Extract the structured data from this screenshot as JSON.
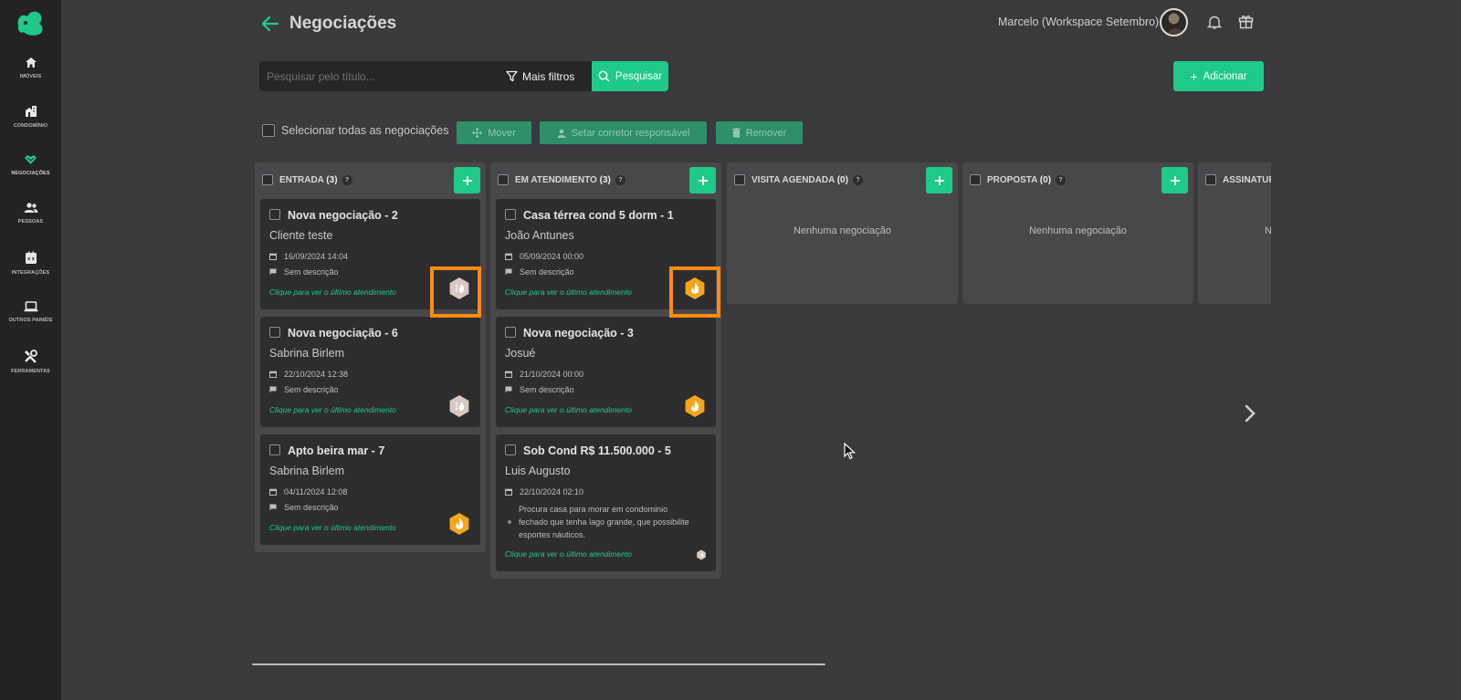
{
  "sidebar": {
    "items": [
      {
        "label": "IMÓVEIS",
        "icon": "home-icon"
      },
      {
        "label": "CONDOMÍNIO",
        "icon": "building-icon"
      },
      {
        "label": "NEGOCIAÇÕES",
        "icon": "handshake-icon"
      },
      {
        "label": "PESSOAS",
        "icon": "people-icon"
      },
      {
        "label": "INTEGRAÇÕES",
        "icon": "integration-icon"
      },
      {
        "label": "OUTROS PAINÉIS",
        "icon": "laptop-icon"
      },
      {
        "label": "FERRAMENTAS",
        "icon": "tools-icon"
      }
    ],
    "active": "NEGOCIAÇÕES"
  },
  "header": {
    "title": "Negociações",
    "user": "Marcelo (Workspace Setembro)"
  },
  "toolbar": {
    "search_placeholder": "Pesquisar pelo título...",
    "more_filters": "Mais filtros",
    "search_button": "Pesquisar",
    "add_button": "Adicionar"
  },
  "bulk": {
    "select_all": "Selecionar todas as negociações",
    "move": "Mover",
    "set_broker": "Setar corretor responsável",
    "remove": "Remover"
  },
  "columns": [
    {
      "title": "ENTRADA",
      "count": "(3)",
      "cards": [
        {
          "title": "Nova negociação - 2",
          "client": "Cliente teste",
          "date": "16/09/2024 14:04",
          "desc": "Sem descrição",
          "link": "Clique para ver o último atendimento",
          "temp": "cold-icon"
        },
        {
          "title": "Nova negociação - 6",
          "client": "Sabrina Birlem",
          "date": "22/10/2024 12:38",
          "desc": "Sem descrição",
          "link": "Clique para ver o último atendimento",
          "temp": "cold-icon"
        },
        {
          "title": "Apto beira mar - 7",
          "client": "Sabrina Birlem",
          "date": "04/11/2024 12:08",
          "desc": "Sem descrição",
          "link": "Clique para ver o último atendimento",
          "temp": "hot-icon"
        }
      ]
    },
    {
      "title": "EM ATENDIMENTO",
      "count": "(3)",
      "cards": [
        {
          "title": "Casa térrea cond 5 dorm - 1",
          "client": "João Antunes",
          "date": "05/09/2024 00:00",
          "desc": "Sem descrição",
          "link": "Clique para ver o último atendimento",
          "temp": "hot-icon"
        },
        {
          "title": "Nova negociação - 3",
          "client": "Josué",
          "date": "21/10/2024 00:00",
          "desc": "Sem descrição",
          "link": "Clique para ver o último atendimento",
          "temp": "hot-icon"
        },
        {
          "title": "Sob Cond R$ 11.500.000 - 5",
          "client": "Luis Augusto",
          "date": "22/10/2024 02:10",
          "desc": "Procura casa para morar em condominio fechado que tenha lago grande, que possibilite esportes náuticos.",
          "link": "Clique para ver o último atendimento",
          "temp": "cold-icon"
        }
      ]
    },
    {
      "title": "VISITA AGENDADA",
      "count": "(0)",
      "empty": "Nenhuma negociação"
    },
    {
      "title": "PROPOSTA",
      "count": "(0)",
      "empty": "Nenhuma negociação"
    },
    {
      "title": "ASSINATURA",
      "count": "",
      "empty": "Nenhuma negociação"
    }
  ],
  "colors": {
    "accent": "#1fc98a",
    "highlight": "#ff8a14",
    "hot": "#f5a51b",
    "cold": "#d8c8c2"
  }
}
